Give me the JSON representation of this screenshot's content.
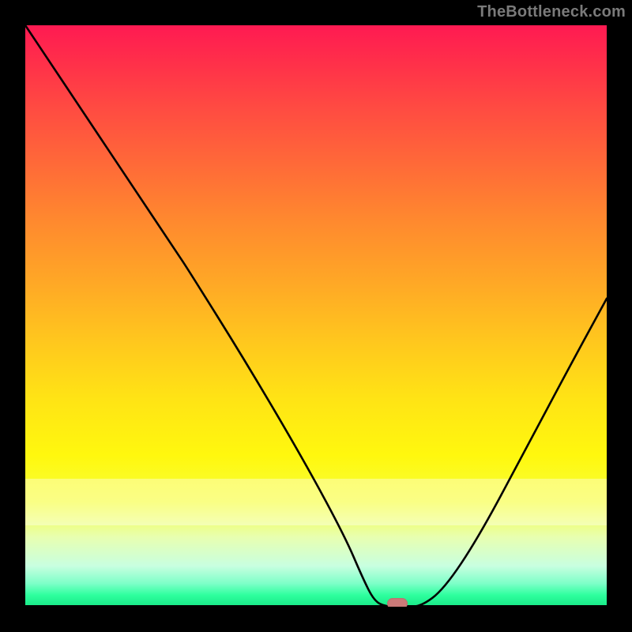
{
  "watermark": "TheBottleneck.com",
  "colors": {
    "frame_bg": "#000000",
    "curve": "#000000",
    "marker": "#cb7a78",
    "watermark": "#7a7a7a"
  },
  "chart_data": {
    "type": "line",
    "title": "",
    "xlabel": "",
    "ylabel": "",
    "xlim": [
      0,
      100
    ],
    "ylim": [
      0,
      100
    ],
    "x": [
      0,
      4,
      10,
      18,
      26,
      28,
      38,
      48,
      55,
      58,
      60,
      62,
      65,
      68,
      72,
      78,
      86,
      94,
      100
    ],
    "y": [
      100,
      94,
      85,
      73,
      61,
      58,
      42,
      25,
      12,
      5,
      1,
      0,
      0,
      0,
      3,
      12,
      27,
      42,
      53
    ],
    "marker": {
      "x": 64,
      "y": 0
    },
    "notes": "Values estimated from plot; y=0 is the green bottom, y=100 is the red top."
  }
}
